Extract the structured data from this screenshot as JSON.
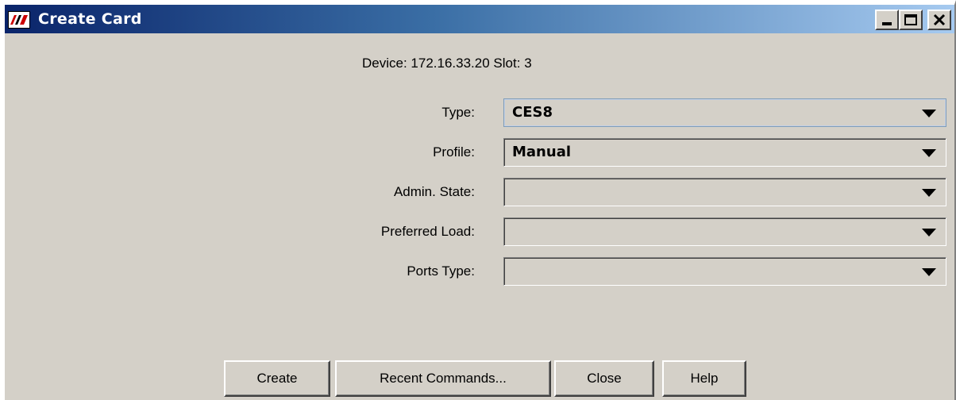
{
  "window": {
    "title": "Create Card",
    "controls": {
      "minimize": "minimize",
      "maximize": "maximize",
      "close": "close"
    }
  },
  "info": {
    "device_label": "Device:",
    "device_value": "172.16.33.20",
    "slot_label": "Slot:",
    "slot_value": "3"
  },
  "form": {
    "fields": [
      {
        "label": "Type:",
        "value": "CES8"
      },
      {
        "label": "Profile:",
        "value": "Manual"
      },
      {
        "label": "Admin. State:",
        "value": ""
      },
      {
        "label": "Preferred Load:",
        "value": ""
      },
      {
        "label": "Ports Type:",
        "value": ""
      }
    ]
  },
  "buttons": {
    "create": "Create",
    "recent": "Recent Commands...",
    "close": "Close",
    "help": "Help"
  },
  "colors": {
    "title_gradient_start": "#0a246a",
    "title_gradient_end": "#a6caf0",
    "dialog_background": "#d4d0c8"
  }
}
